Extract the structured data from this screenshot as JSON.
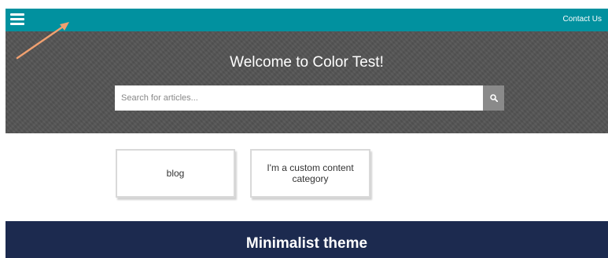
{
  "topbar": {
    "menu_icon": "hamburger-menu-icon",
    "contact_label": "Contact Us",
    "color": "#01919f"
  },
  "hero": {
    "title": "Welcome to Color Test!",
    "search": {
      "placeholder": "Search for articles...",
      "button_icon": "search-icon"
    }
  },
  "categories": [
    {
      "label": "blog"
    },
    {
      "label": "I'm a custom content category"
    }
  ],
  "footer": {
    "title": "Minimalist theme",
    "color": "#1c2a4f"
  },
  "annotation": {
    "icon": "arrow-annotation",
    "color": "#f0a070"
  }
}
